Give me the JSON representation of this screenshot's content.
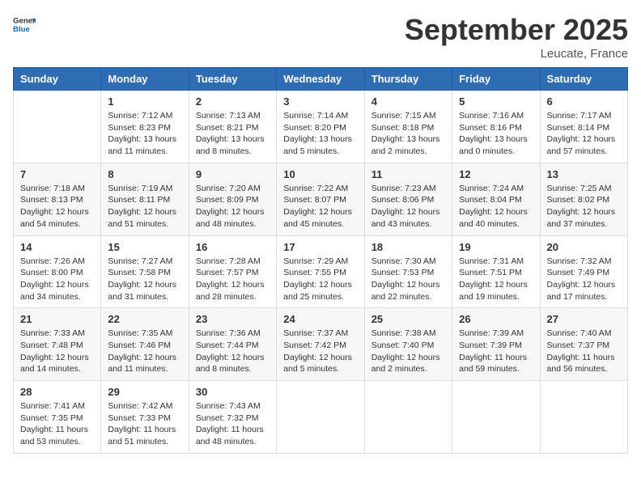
{
  "header": {
    "logo_line1": "General",
    "logo_line2": "Blue",
    "month_title": "September 2025",
    "location": "Leucate, France"
  },
  "weekdays": [
    "Sunday",
    "Monday",
    "Tuesday",
    "Wednesday",
    "Thursday",
    "Friday",
    "Saturday"
  ],
  "weeks": [
    [
      {
        "day": "",
        "info": ""
      },
      {
        "day": "1",
        "info": "Sunrise: 7:12 AM\nSunset: 8:23 PM\nDaylight: 13 hours\nand 11 minutes."
      },
      {
        "day": "2",
        "info": "Sunrise: 7:13 AM\nSunset: 8:21 PM\nDaylight: 13 hours\nand 8 minutes."
      },
      {
        "day": "3",
        "info": "Sunrise: 7:14 AM\nSunset: 8:20 PM\nDaylight: 13 hours\nand 5 minutes."
      },
      {
        "day": "4",
        "info": "Sunrise: 7:15 AM\nSunset: 8:18 PM\nDaylight: 13 hours\nand 2 minutes."
      },
      {
        "day": "5",
        "info": "Sunrise: 7:16 AM\nSunset: 8:16 PM\nDaylight: 13 hours\nand 0 minutes."
      },
      {
        "day": "6",
        "info": "Sunrise: 7:17 AM\nSunset: 8:14 PM\nDaylight: 12 hours\nand 57 minutes."
      }
    ],
    [
      {
        "day": "7",
        "info": "Sunrise: 7:18 AM\nSunset: 8:13 PM\nDaylight: 12 hours\nand 54 minutes."
      },
      {
        "day": "8",
        "info": "Sunrise: 7:19 AM\nSunset: 8:11 PM\nDaylight: 12 hours\nand 51 minutes."
      },
      {
        "day": "9",
        "info": "Sunrise: 7:20 AM\nSunset: 8:09 PM\nDaylight: 12 hours\nand 48 minutes."
      },
      {
        "day": "10",
        "info": "Sunrise: 7:22 AM\nSunset: 8:07 PM\nDaylight: 12 hours\nand 45 minutes."
      },
      {
        "day": "11",
        "info": "Sunrise: 7:23 AM\nSunset: 8:06 PM\nDaylight: 12 hours\nand 43 minutes."
      },
      {
        "day": "12",
        "info": "Sunrise: 7:24 AM\nSunset: 8:04 PM\nDaylight: 12 hours\nand 40 minutes."
      },
      {
        "day": "13",
        "info": "Sunrise: 7:25 AM\nSunset: 8:02 PM\nDaylight: 12 hours\nand 37 minutes."
      }
    ],
    [
      {
        "day": "14",
        "info": "Sunrise: 7:26 AM\nSunset: 8:00 PM\nDaylight: 12 hours\nand 34 minutes."
      },
      {
        "day": "15",
        "info": "Sunrise: 7:27 AM\nSunset: 7:58 PM\nDaylight: 12 hours\nand 31 minutes."
      },
      {
        "day": "16",
        "info": "Sunrise: 7:28 AM\nSunset: 7:57 PM\nDaylight: 12 hours\nand 28 minutes."
      },
      {
        "day": "17",
        "info": "Sunrise: 7:29 AM\nSunset: 7:55 PM\nDaylight: 12 hours\nand 25 minutes."
      },
      {
        "day": "18",
        "info": "Sunrise: 7:30 AM\nSunset: 7:53 PM\nDaylight: 12 hours\nand 22 minutes."
      },
      {
        "day": "19",
        "info": "Sunrise: 7:31 AM\nSunset: 7:51 PM\nDaylight: 12 hours\nand 19 minutes."
      },
      {
        "day": "20",
        "info": "Sunrise: 7:32 AM\nSunset: 7:49 PM\nDaylight: 12 hours\nand 17 minutes."
      }
    ],
    [
      {
        "day": "21",
        "info": "Sunrise: 7:33 AM\nSunset: 7:48 PM\nDaylight: 12 hours\nand 14 minutes."
      },
      {
        "day": "22",
        "info": "Sunrise: 7:35 AM\nSunset: 7:46 PM\nDaylight: 12 hours\nand 11 minutes."
      },
      {
        "day": "23",
        "info": "Sunrise: 7:36 AM\nSunset: 7:44 PM\nDaylight: 12 hours\nand 8 minutes."
      },
      {
        "day": "24",
        "info": "Sunrise: 7:37 AM\nSunset: 7:42 PM\nDaylight: 12 hours\nand 5 minutes."
      },
      {
        "day": "25",
        "info": "Sunrise: 7:38 AM\nSunset: 7:40 PM\nDaylight: 12 hours\nand 2 minutes."
      },
      {
        "day": "26",
        "info": "Sunrise: 7:39 AM\nSunset: 7:39 PM\nDaylight: 11 hours\nand 59 minutes."
      },
      {
        "day": "27",
        "info": "Sunrise: 7:40 AM\nSunset: 7:37 PM\nDaylight: 11 hours\nand 56 minutes."
      }
    ],
    [
      {
        "day": "28",
        "info": "Sunrise: 7:41 AM\nSunset: 7:35 PM\nDaylight: 11 hours\nand 53 minutes."
      },
      {
        "day": "29",
        "info": "Sunrise: 7:42 AM\nSunset: 7:33 PM\nDaylight: 11 hours\nand 51 minutes."
      },
      {
        "day": "30",
        "info": "Sunrise: 7:43 AM\nSunset: 7:32 PM\nDaylight: 11 hours\nand 48 minutes."
      },
      {
        "day": "",
        "info": ""
      },
      {
        "day": "",
        "info": ""
      },
      {
        "day": "",
        "info": ""
      },
      {
        "day": "",
        "info": ""
      }
    ]
  ]
}
